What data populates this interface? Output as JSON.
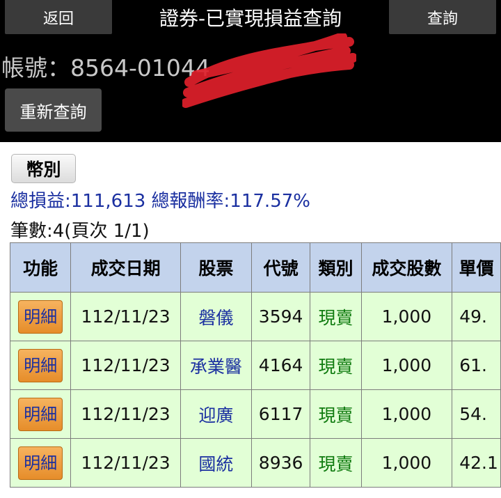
{
  "header": {
    "back_label": "返回",
    "title": "證券-已實現損益查詢",
    "query_label": "查詢"
  },
  "account": {
    "label": "帳號：8564-01044"
  },
  "requery_label": "重新查詢",
  "currency_label": "幣別",
  "summary": {
    "text": "總損益:111,613 總報酬率:117.57%"
  },
  "count_text": "筆數:4(頁次 1/1)",
  "table": {
    "headers": [
      "功能",
      "成交日期",
      "股票",
      "代號",
      "類別",
      "成交股數",
      "單價"
    ],
    "rows": [
      {
        "action": "明細",
        "date": "112/11/23",
        "stock": "磐儀",
        "code": "3594",
        "type": "現賣",
        "shares": "1,000",
        "price": "49."
      },
      {
        "action": "明細",
        "date": "112/11/23",
        "stock": "承業醫",
        "code": "4164",
        "type": "現賣",
        "shares": "1,000",
        "price": "61."
      },
      {
        "action": "明細",
        "date": "112/11/23",
        "stock": "迎廣",
        "code": "6117",
        "type": "現賣",
        "shares": "1,000",
        "price": "54."
      },
      {
        "action": "明細",
        "date": "112/11/23",
        "stock": "國統",
        "code": "8936",
        "type": "現賣",
        "shares": "1,000",
        "price": "42.1"
      }
    ]
  },
  "colors": {
    "header_bg": "#000000",
    "table_header_bg": "#c3d3ec",
    "row_bg": "#e2ffd6",
    "link_blue": "#1a2fa0",
    "sell_green": "#0e7a0e",
    "detail_button": "#f0a040",
    "redaction": "#e0202a"
  }
}
